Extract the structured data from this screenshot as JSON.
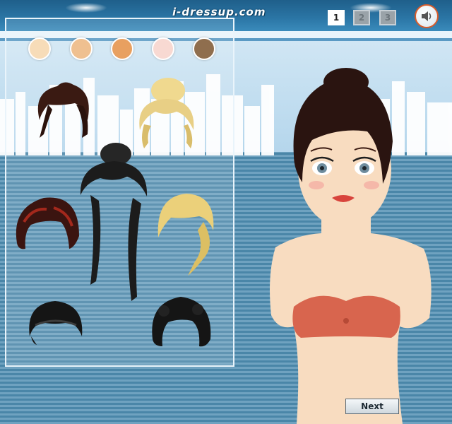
{
  "site": {
    "logo_text": "i-dressup.com"
  },
  "pagination": {
    "pages": [
      "1",
      "2",
      "3"
    ],
    "current": "1"
  },
  "sound": {
    "icon": "speaker-icon"
  },
  "skin_tones": [
    "#f7dcb8",
    "#efc090",
    "#e8a060",
    "#f8d9d2",
    "#8f6e4e"
  ],
  "hairstyles": [
    {
      "name": "dark-brown-updo",
      "color": "#3a1a12"
    },
    {
      "name": "blonde-messy-bun",
      "color": "#e8cf85"
    },
    {
      "name": "black-long-bun-ponytails",
      "color": "#1c1c1c"
    },
    {
      "name": "red-black-short-curly",
      "color": "#3b1410"
    },
    {
      "name": "blonde-side-ponytail",
      "color": "#ebd07a"
    },
    {
      "name": "black-short-headband",
      "color": "#151515"
    },
    {
      "name": "black-curly-bob",
      "color": "#151515"
    }
  ],
  "model": {
    "top_color": "#d8654e",
    "hair_color": "#2a1410",
    "skin_color": "#f8dcc0"
  },
  "controls": {
    "next_label": "Next"
  }
}
